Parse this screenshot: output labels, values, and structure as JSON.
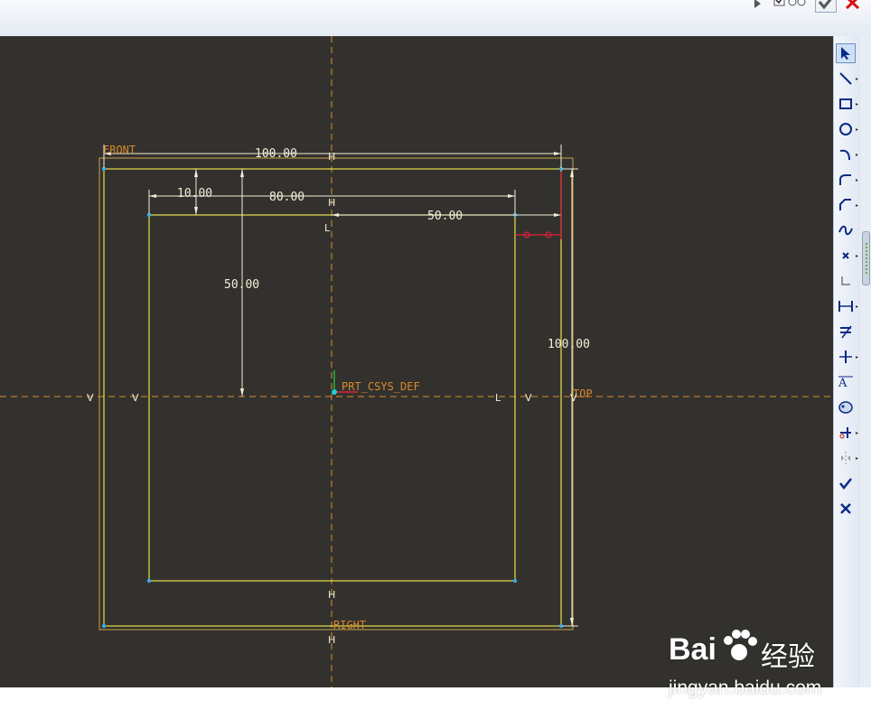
{
  "toolbar": {
    "tools": [
      {
        "name": "select-tool",
        "icon": "arrow-pointer-icon",
        "active": true,
        "flyout": false
      },
      {
        "name": "line-tool",
        "icon": "line-icon",
        "active": false,
        "flyout": true
      },
      {
        "name": "rectangle-tool",
        "icon": "rectangle-icon",
        "active": false,
        "flyout": true
      },
      {
        "name": "circle-tool",
        "icon": "circle-icon",
        "active": false,
        "flyout": true
      },
      {
        "name": "arc-tool",
        "icon": "arc-icon",
        "active": false,
        "flyout": true
      },
      {
        "name": "fillet-tool",
        "icon": "fillet-icon",
        "active": false,
        "flyout": true
      },
      {
        "name": "chamfer-tool",
        "icon": "chamfer-icon",
        "active": false,
        "flyout": true
      },
      {
        "name": "spline-tool",
        "icon": "spline-icon",
        "active": false,
        "flyout": false
      },
      {
        "name": "point-tool",
        "icon": "point-x-icon",
        "active": false,
        "flyout": true
      },
      {
        "name": "csys-tool",
        "icon": "corner-icon",
        "active": false,
        "flyout": false
      },
      {
        "name": "dimension-tool",
        "icon": "dimension-icon",
        "active": false,
        "flyout": true
      },
      {
        "name": "modify-tool",
        "icon": "modify-icon",
        "active": false,
        "flyout": false
      },
      {
        "name": "constraint-tool",
        "icon": "constraint-icon",
        "active": false,
        "flyout": true
      },
      {
        "name": "text-tool",
        "icon": "text-icon",
        "active": false,
        "flyout": false
      },
      {
        "name": "palette-tool",
        "icon": "palette-icon",
        "active": false,
        "flyout": false
      },
      {
        "name": "trim-tool",
        "icon": "trim-icon",
        "active": false,
        "flyout": true
      },
      {
        "name": "mirror-tool",
        "icon": "mirror-icon",
        "active": false,
        "flyout": true
      },
      {
        "name": "accept-tool",
        "icon": "checkmark-icon",
        "active": false,
        "flyout": false
      },
      {
        "name": "cancel-tool",
        "icon": "x-icon",
        "active": false,
        "flyout": false
      }
    ]
  },
  "sketch": {
    "labels": {
      "front": "FRONT",
      "top": "TOP",
      "right": "RIGHT",
      "csys": "PRT_CSYS_DEF"
    },
    "dimensions": {
      "outer_width": "100.00",
      "outer_height": "100.00",
      "inner_width": "80.00",
      "offset_left": "10.00",
      "half_height": "50.00",
      "half_width": "50.00"
    },
    "constraint_marks": {
      "vertical": "V",
      "horizontal": "H",
      "line": "L"
    }
  },
  "watermark": {
    "brand": "Bai",
    "brand_suffix": "经验",
    "url": "jingyan.baidu.com"
  },
  "colors": {
    "canvas": "#33312e",
    "geometry": "#e8e04a",
    "dimension": "#f2efd8",
    "reference": "#d98a2a",
    "constraint_red": "#e0203a",
    "vertex": "#3aa6e6"
  }
}
